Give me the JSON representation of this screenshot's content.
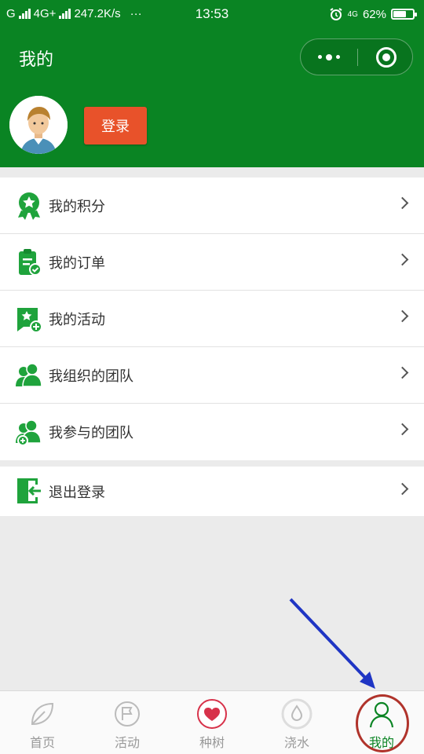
{
  "status_bar": {
    "carrier_left": "G",
    "network": "4G+",
    "speed": "247.2K/s",
    "more": "···",
    "time": "13:53",
    "network_right": "4G",
    "battery_percent": "62%",
    "battery_level": 0.62
  },
  "header": {
    "title": "我的",
    "login_label": "登录",
    "background_color": "#0a8423"
  },
  "menu": {
    "items": [
      {
        "label": "我的积分",
        "icon": "badge-star-icon"
      },
      {
        "label": "我的订单",
        "icon": "clipboard-check-icon"
      },
      {
        "label": "我的活动",
        "icon": "flag-star-icon"
      },
      {
        "label": "我组织的团队",
        "icon": "team-icon"
      },
      {
        "label": "我参与的团队",
        "icon": "team-add-icon"
      }
    ],
    "logout": {
      "label": "退出登录",
      "icon": "exit-door-icon"
    }
  },
  "tabbar": {
    "tabs": [
      {
        "label": "首页",
        "icon": "leaf-icon"
      },
      {
        "label": "活动",
        "icon": "flag-circle-icon"
      },
      {
        "label": "种树",
        "icon": "heart-circle-icon"
      },
      {
        "label": "浇水",
        "icon": "water-drop-icon"
      },
      {
        "label": "我的",
        "icon": "person-icon",
        "active": true
      }
    ]
  },
  "colors": {
    "brand_green": "#0a8423",
    "login_button": "#e8522a",
    "annotation_arrow": "#1f35c4",
    "annotation_circle": "#b0332b"
  }
}
